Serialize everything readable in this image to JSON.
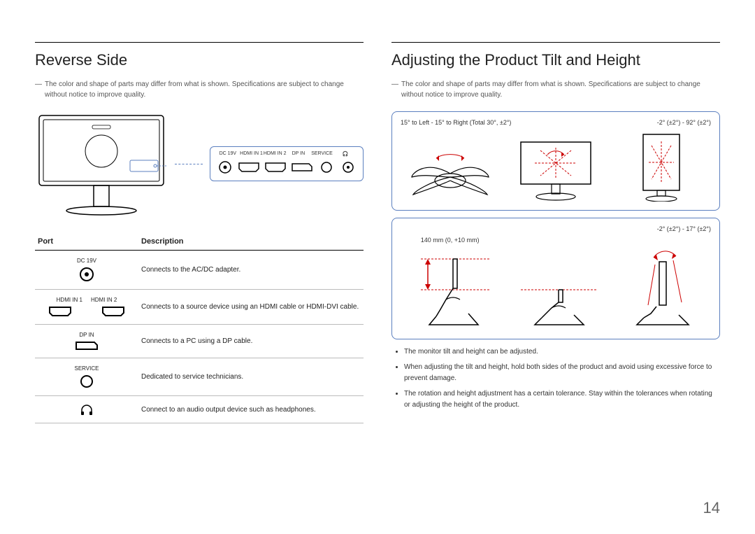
{
  "page_number": "14",
  "left": {
    "title": "Reverse Side",
    "note": "The color and shape of parts may differ from what is shown. Specifications are subject to change without notice to improve quality.",
    "panel_labels": [
      "DC 19V",
      "HDMI IN 1",
      "HDMI IN 2",
      "DP IN",
      "SERVICE",
      "🎧"
    ],
    "table": {
      "headers": [
        "Port",
        "Description"
      ],
      "rows": [
        {
          "port": "DC 19V",
          "desc": "Connects to the AC/DC adapter.",
          "icon": "dc"
        },
        {
          "port_a": "HDMI IN 1",
          "port_b": "HDMI IN 2",
          "desc": "Connects to a source device using an HDMI cable or HDMI-DVI cable.",
          "icon": "hdmi-pair"
        },
        {
          "port": "DP IN",
          "desc": "Connects to a PC using a DP cable.",
          "icon": "dp"
        },
        {
          "port": "SERVICE",
          "desc": "Dedicated to service technicians.",
          "icon": "service"
        },
        {
          "port": "",
          "desc": "Connect to an audio output device such as headphones.",
          "icon": "headphones"
        }
      ]
    }
  },
  "right": {
    "title": "Adjusting the Product Tilt and Height",
    "note": "The color and shape of parts may differ from what is shown. Specifications are subject to change without notice to improve quality.",
    "swivel_range": "15° to Left - 15° to Right (Total 30°, ±2°)",
    "pivot_range": "-2° (±2°) - 92° (±2°)",
    "height_range": "140 mm (0, +10 mm)",
    "tilt_range": "-2° (±2°) - 17° (±2°)",
    "bullets": [
      "The monitor tilt and height can be adjusted.",
      "When adjusting the tilt and height, hold both sides of the product and avoid using excessive force to prevent damage.",
      "The rotation and height adjustment has a certain tolerance. Stay within the tolerances when rotating or adjusting the height of the product."
    ]
  }
}
